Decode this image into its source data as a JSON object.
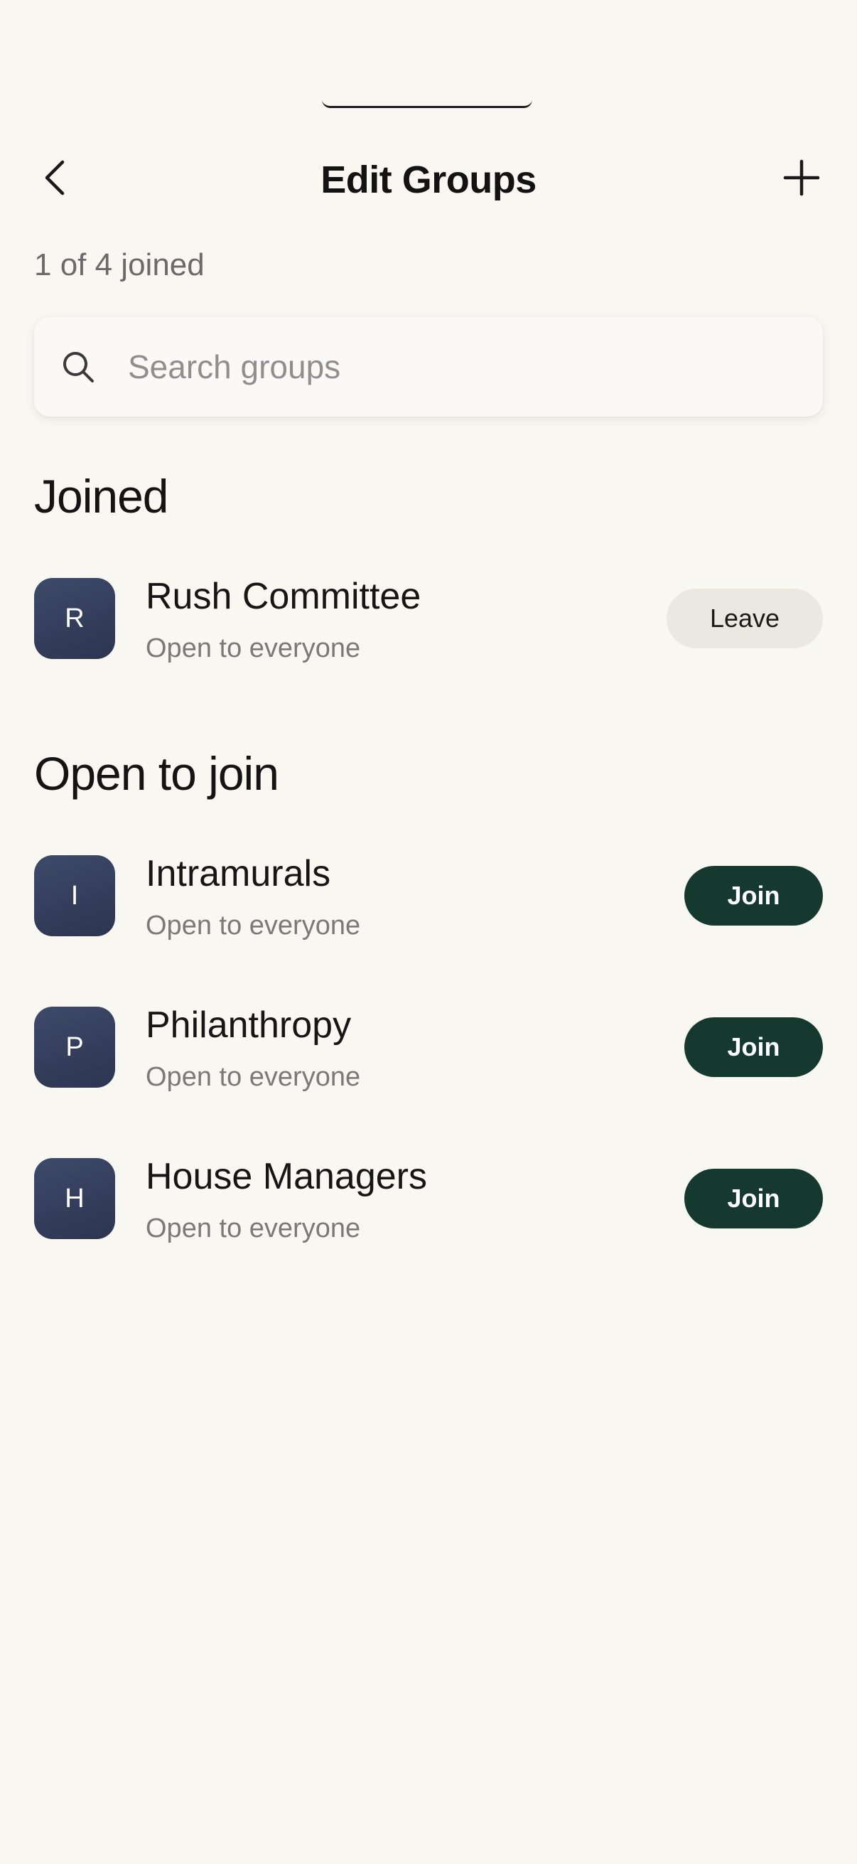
{
  "header": {
    "title": "Edit Groups",
    "back_icon": "chevron-left-icon",
    "add_icon": "plus-icon"
  },
  "summary": {
    "joined_count": "1 of 4 joined"
  },
  "search": {
    "placeholder": "Search groups",
    "value": "",
    "icon": "search-icon"
  },
  "sections": {
    "joined": {
      "title": "Joined",
      "groups": [
        {
          "initial": "R",
          "name": "Rush Committee",
          "subtitle": "Open to everyone",
          "action": "Leave"
        }
      ]
    },
    "open": {
      "title": "Open to join",
      "groups": [
        {
          "initial": "I",
          "name": "Intramurals",
          "subtitle": "Open to everyone",
          "action": "Join"
        },
        {
          "initial": "P",
          "name": "Philanthropy",
          "subtitle": "Open to everyone",
          "action": "Join"
        },
        {
          "initial": "H",
          "name": "House Managers",
          "subtitle": "Open to everyone",
          "action": "Join"
        }
      ]
    }
  },
  "colors": {
    "background": "#f9f7f2",
    "join_button": "#16392f",
    "leave_button": "#ebe8e2",
    "avatar": "#333d5a"
  }
}
